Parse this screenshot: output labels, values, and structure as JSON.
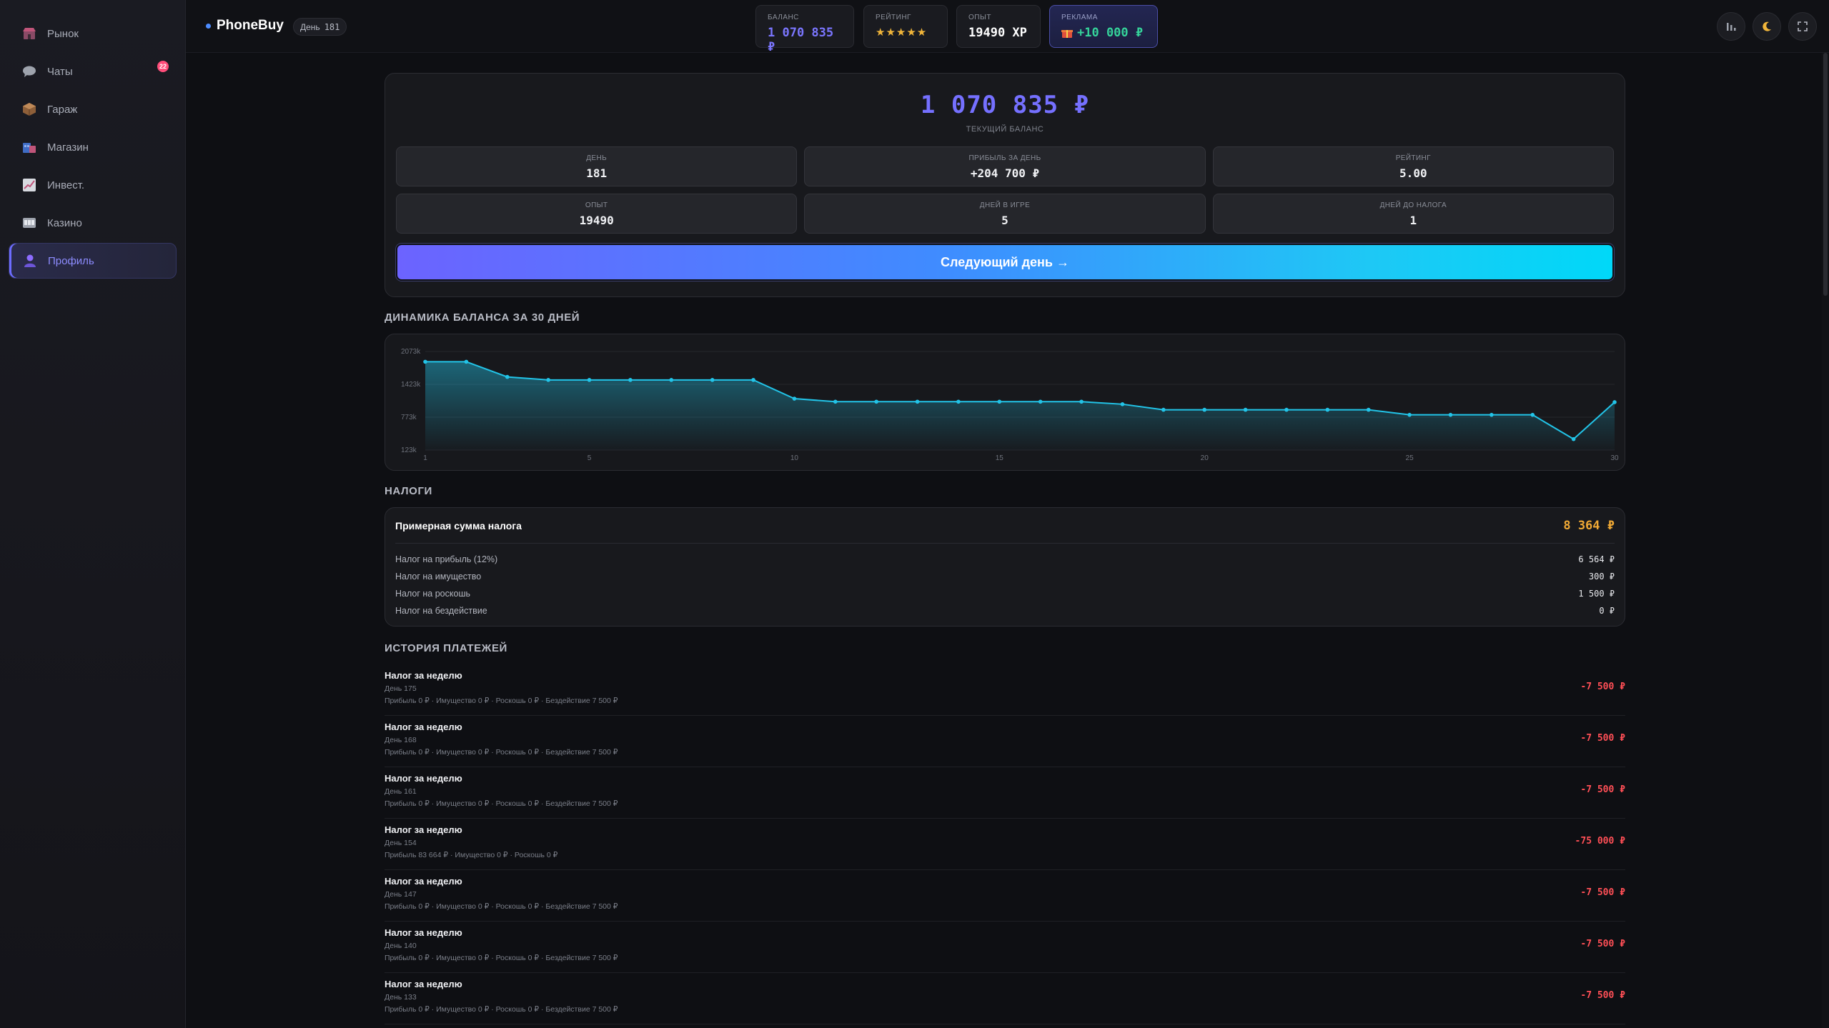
{
  "sidebar": {
    "items": [
      {
        "label": "Рынок",
        "icon": "store-icon",
        "color": "#c0557a"
      },
      {
        "label": "Чаты",
        "icon": "chat-icon",
        "color": "#9ea3ad",
        "badge": "22"
      },
      {
        "label": "Гараж",
        "icon": "garage-box-icon",
        "color": "#b07a4a"
      },
      {
        "label": "Магазин",
        "icon": "shop-icon",
        "color": "#4d7fd9"
      },
      {
        "label": "Инвест.",
        "icon": "chart-icon",
        "color": "#b7bcc5"
      },
      {
        "label": "Казино",
        "icon": "casino-icon",
        "color": "#b7bcc5"
      },
      {
        "label": "Профиль",
        "icon": "profile-icon",
        "color": "#8d6cff",
        "active": true
      }
    ]
  },
  "header": {
    "brand": "PhoneBuy",
    "day_label": "День",
    "day_value": "181",
    "stats": {
      "balance": {
        "label": "БАЛАНС",
        "value": "1 070 835 ₽"
      },
      "rating": {
        "label": "РЕЙТИНГ",
        "value": "★★★★★"
      },
      "xp": {
        "label": "ОПЫТ",
        "value": "19490 XP"
      },
      "ad": {
        "label": "РЕКЛАМА",
        "value": "+10 000 ₽"
      }
    },
    "buttons": [
      "stats-icon",
      "moon-icon",
      "fullscreen-icon"
    ]
  },
  "profile": {
    "balance": "1 070 835 ₽",
    "balance_label": "ТЕКУЩИЙ БАЛАНС",
    "cells": [
      {
        "label": "ДЕНЬ",
        "value": "181"
      },
      {
        "label": "ПРИБЫЛЬ ЗА ДЕНЬ",
        "value": "+204 700 ₽"
      },
      {
        "label": "РЕЙТИНГ",
        "value": "5.00"
      },
      {
        "label": "ОПЫТ",
        "value": "19490"
      },
      {
        "label": "ДНЕЙ В ИГРЕ",
        "value": "5"
      },
      {
        "label": "ДНЕЙ ДО НАЛОГА",
        "value": "1"
      }
    ],
    "next_day_label": "Следующий день →"
  },
  "chart_title": "ДИНАМИКА БАЛАНСА ЗА 30 ДНЕЙ",
  "chart_data": {
    "type": "area",
    "x": [
      1,
      2,
      3,
      4,
      5,
      6,
      7,
      8,
      9,
      10,
      11,
      12,
      13,
      14,
      15,
      16,
      17,
      18,
      19,
      20,
      21,
      22,
      23,
      24,
      25,
      26,
      27,
      28,
      29,
      30
    ],
    "values": [
      1870,
      1870,
      1570,
      1510,
      1510,
      1510,
      1510,
      1510,
      1510,
      1140,
      1080,
      1080,
      1080,
      1080,
      1080,
      1080,
      1080,
      1030,
      920,
      920,
      920,
      920,
      920,
      920,
      820,
      820,
      820,
      820,
      340,
      1070
    ],
    "ylim": [
      123,
      2073
    ],
    "yticks": [
      {
        "v": 2073,
        "label": "2073k"
      },
      {
        "v": 1423,
        "label": "1423k"
      },
      {
        "v": 773,
        "label": "773k"
      },
      {
        "v": 123,
        "label": "123k"
      }
    ],
    "xticks": [
      1,
      5,
      10,
      15,
      20,
      25,
      30
    ],
    "grid": true,
    "color": "#22c4e8"
  },
  "taxes": {
    "title": "НАЛОГИ",
    "estimate_label": "Примерная сумма налога",
    "estimate_value": "8 364 ₽",
    "rows": [
      {
        "label": "Налог на прибыль (12%)",
        "value": "6 564 ₽"
      },
      {
        "label": "Налог на имущество",
        "value": "300 ₽"
      },
      {
        "label": "Налог на роскошь",
        "value": "1 500 ₽"
      },
      {
        "label": "Налог на бездействие",
        "value": "0 ₽"
      }
    ]
  },
  "payments": {
    "title": "ИСТОРИЯ ПЛАТЕЖЕЙ",
    "rows": [
      {
        "title": "Налог за неделю",
        "day": "День 175",
        "breakdown": "Прибыль 0 ₽ · Имущество 0 ₽ · Роскошь 0 ₽ · Бездействие 7 500 ₽",
        "amount": "-7 500 ₽"
      },
      {
        "title": "Налог за неделю",
        "day": "День 168",
        "breakdown": "Прибыль 0 ₽ · Имущество 0 ₽ · Роскошь 0 ₽ · Бездействие 7 500 ₽",
        "amount": "-7 500 ₽"
      },
      {
        "title": "Налог за неделю",
        "day": "День 161",
        "breakdown": "Прибыль 0 ₽ · Имущество 0 ₽ · Роскошь 0 ₽ · Бездействие 7 500 ₽",
        "amount": "-7 500 ₽"
      },
      {
        "title": "Налог за неделю",
        "day": "День 154",
        "breakdown": "Прибыль 83 664 ₽ · Имущество 0 ₽ · Роскошь 0 ₽",
        "amount": "-75 000 ₽"
      },
      {
        "title": "Налог за неделю",
        "day": "День 147",
        "breakdown": "Прибыль 0 ₽ · Имущество 0 ₽ · Роскошь 0 ₽ · Бездействие 7 500 ₽",
        "amount": "-7 500 ₽"
      },
      {
        "title": "Налог за неделю",
        "day": "День 140",
        "breakdown": "Прибыль 0 ₽ · Имущество 0 ₽ · Роскошь 0 ₽ · Бездействие 7 500 ₽",
        "amount": "-7 500 ₽"
      },
      {
        "title": "Налог за неделю",
        "day": "День 133",
        "breakdown": "Прибыль 0 ₽ · Имущество 0 ₽ · Роскошь 0 ₽ · Бездействие 7 500 ₽",
        "amount": "-7 500 ₽"
      }
    ]
  }
}
